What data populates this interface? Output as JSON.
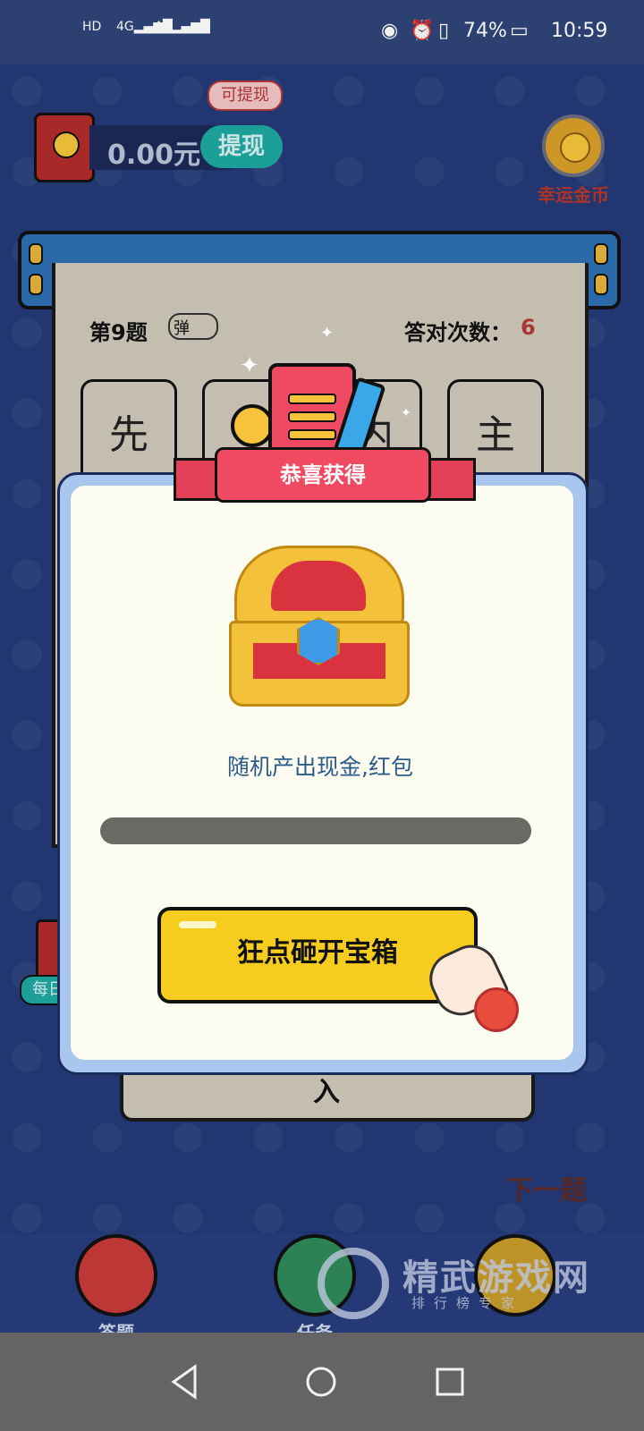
{
  "status_bar": {
    "left_icons": [
      "hd-icon",
      "4g-signal-icon",
      "4g-signal-icon",
      "wifi-icon"
    ],
    "battery": "74%",
    "time": "10:59"
  },
  "header": {
    "balance": "0.00元",
    "withdraw_label": "提现",
    "can_withdraw_badge": "可提现",
    "lucky_coin_label": "幸运金币"
  },
  "question": {
    "number_label": "第9题",
    "toggle_label": "弹",
    "correct_label": "答对次数：",
    "correct_count": "6",
    "tiles": [
      "先",
      "",
      "内",
      "主"
    ],
    "input_char": "入"
  },
  "side": {
    "next_label": "下一题",
    "daily_label": "每日"
  },
  "modal": {
    "ribbon_title": "恭喜获得",
    "reward_description": "随机产出现金,红包",
    "progress_fraction": 0,
    "smash_button_label": "狂点砸开宝箱"
  },
  "bottom_nav": {
    "items": [
      {
        "label": "答题",
        "icon": "pk-avatar-icon"
      },
      {
        "label": "任务",
        "icon": "gift-icon"
      },
      {
        "label": "",
        "icon": "wallet-icon"
      }
    ]
  },
  "watermark": {
    "title": "精武游戏网",
    "subtitle": "排行榜专家"
  },
  "colors": {
    "accent_teal": "#1ea7a2",
    "ribbon_red": "#ef4a62",
    "button_yellow": "#f6cd1e",
    "board_beige": "#cfc9bb"
  }
}
